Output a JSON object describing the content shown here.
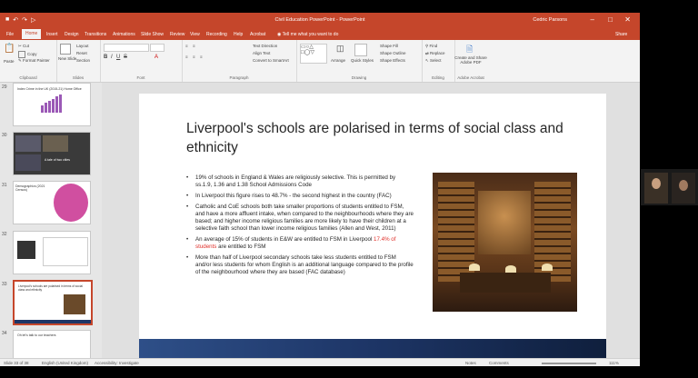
{
  "window": {
    "title": "Civil Education PowerPoint - PowerPoint",
    "user": "Cedric Parsons"
  },
  "tabs": [
    "File",
    "Home",
    "Insert",
    "Design",
    "Transitions",
    "Animations",
    "Slide Show",
    "Review",
    "View",
    "Recording",
    "Help",
    "Acrobat"
  ],
  "tell_me": "Tell me what you want to do",
  "share": "Share",
  "ribbon": {
    "paste": "Paste",
    "cut": "Cut",
    "copy": "Copy",
    "format_painter": "Format Painter",
    "clipboard": "Clipboard",
    "new_slide": "New Slide",
    "layout": "Layout",
    "reset": "Reset",
    "section": "Section",
    "slides": "Slides",
    "font": "Font",
    "paragraph": "Paragraph",
    "text_direction": "Text Direction",
    "align_text": "Align Text",
    "convert_smartart": "Convert to SmartArt",
    "arrange": "Arrange",
    "quick_styles": "Quick Styles",
    "shape_fill": "Shape Fill",
    "shape_outline": "Shape Outline",
    "shape_effects": "Shape Effects",
    "drawing": "Drawing",
    "find": "Find",
    "replace": "Replace",
    "select": "Select",
    "editing": "Editing",
    "create_share": "Create and Share Adobe PDF",
    "adobe_acrobat": "Adobe Acrobat"
  },
  "thumbnails": [
    {
      "num": "29",
      "caption": "Index Crime in the UK (2015-21) Home Office"
    },
    {
      "num": "30",
      "caption": "A tale of two cities"
    },
    {
      "num": "31",
      "caption": "Demographics (2021 Census)"
    },
    {
      "num": "32",
      "caption": ""
    },
    {
      "num": "33",
      "caption": "Liverpool's schools are polarised in terms of social class and ethnicity"
    },
    {
      "num": "34",
      "caption": "Oh let's talk to our teachers"
    }
  ],
  "slide": {
    "title": "Liverpool's schools are polarised in terms of social class and ethnicity",
    "b1": "19% of schools in England & Wales are religiously selective. This is permitted by ss.1.9, 1.36 and 1.38 School Admissions Code",
    "b2": "In Liverpool this figure rises to 48.7% - the second highest in the country (FAC)",
    "b3": "Catholic and CoE schools both take smaller proportions of students entitled to FSM, and have a more affluent intake, when compared to the neighbourhoods where they are based; and higher income religious families are more likely to have their children at a selective faith school than lower income religious families (Allen and West, 2011)",
    "b4_pre": "An average of 15% of students in E&W are entitled to FSM in Liverpool ",
    "b4_hl": "17.4% of students",
    "b4_post": " are entitled to FSM",
    "b5": "More than half of Liverpool secondary schools take less students entitled to FSM and/or less students for whom English is an additional language compared to the profile of the neighbourhood where they are based (FAC database)"
  },
  "status": {
    "slide_of": "Slide 33 of 38",
    "language": "English (United Kingdom)",
    "accessibility": "Accessibility: Investigate",
    "notes": "Notes",
    "comments": "Comments",
    "zoom": "111%"
  },
  "colors": {
    "accent": "#c5462b",
    "highlight": "#e0302a",
    "footer": "#1d3566"
  }
}
